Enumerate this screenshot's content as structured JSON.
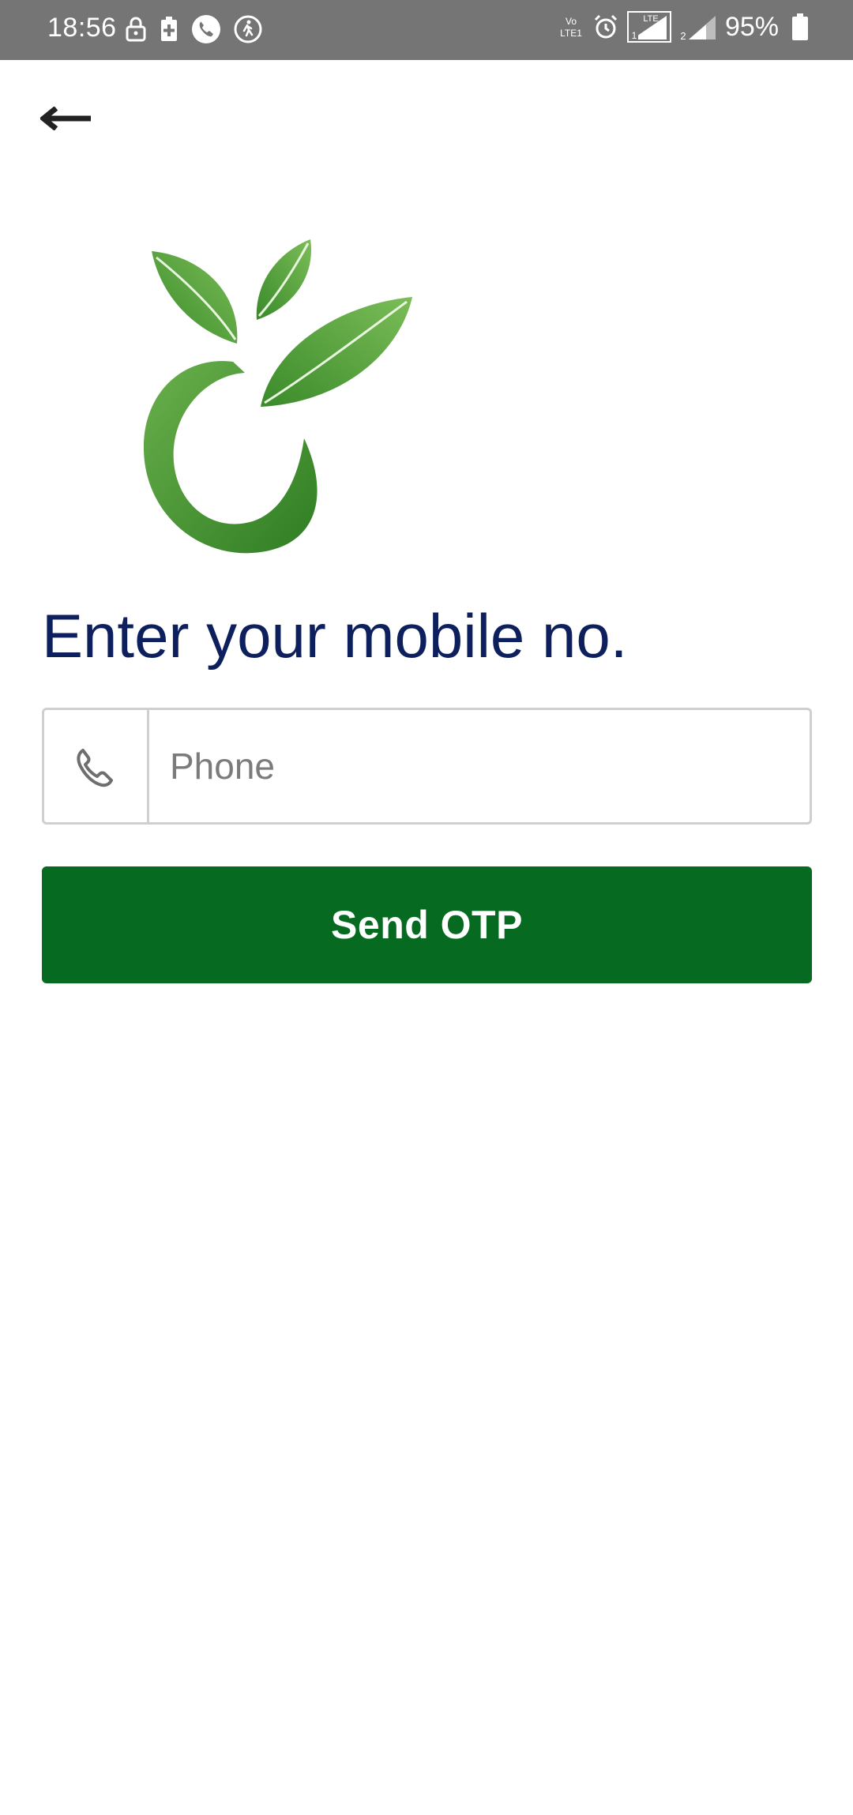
{
  "status_bar": {
    "time": "18:56",
    "battery_percent": "95%",
    "network_label": "VoLTE1",
    "lte_label": "LTE",
    "icons_left": [
      "lock-icon",
      "battery-saver-icon",
      "call-icon",
      "walk-icon"
    ],
    "icons_right": [
      "volte-icon",
      "alarm-icon",
      "signal-sim1-icon",
      "signal-sim2-icon",
      "battery-icon"
    ]
  },
  "nav": {
    "back_icon": "back-arrow-icon"
  },
  "logo": {
    "icon": "leaf-logo-icon",
    "colors": [
      "#3f8f2b",
      "#6ab04c"
    ]
  },
  "login": {
    "heading": "Enter your mobile no.",
    "phone_icon": "phone-icon",
    "phone_placeholder": "Phone",
    "phone_value": "",
    "send_button_label": "Send OTP"
  },
  "colors": {
    "status_bar": "#757575",
    "heading": "#0d1f5c",
    "button": "#066b20",
    "border": "#cfcfcf"
  }
}
